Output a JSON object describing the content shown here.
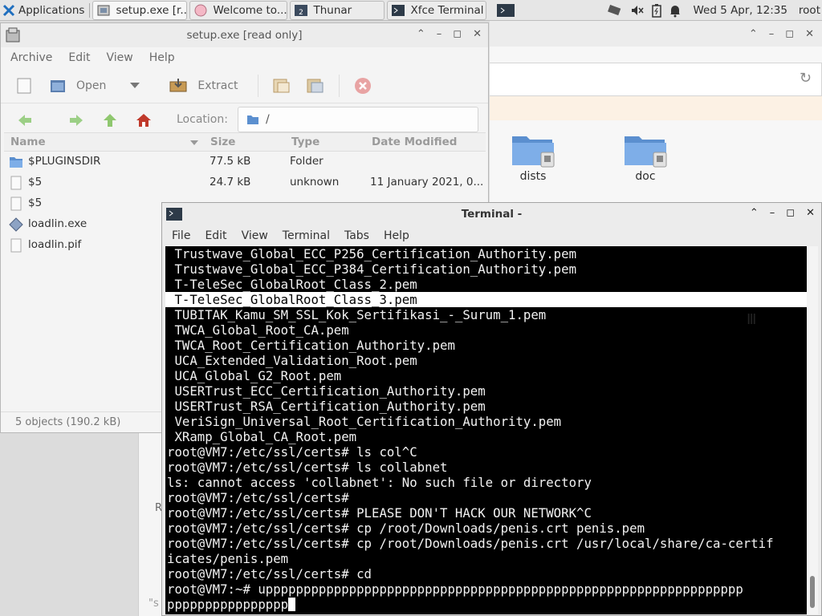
{
  "panel": {
    "applications_label": "Applications",
    "tasks": [
      {
        "label": "setup.exe [r..."
      },
      {
        "label": "Welcome to..."
      },
      {
        "label": "Thunar"
      },
      {
        "label": "Xfce Terminal"
      }
    ],
    "clock": "Wed  5 Apr, 12:35",
    "user": "root"
  },
  "thunar": {
    "folders": [
      {
        "label": "dists"
      },
      {
        "label": "doc"
      }
    ],
    "partial_left_text": "R",
    "partial_left_text2": "\"s"
  },
  "archive": {
    "title": "setup.exe [read only]",
    "menu": [
      "Archive",
      "Edit",
      "View",
      "Help"
    ],
    "toolbar": {
      "open_label": "Open",
      "extract_label": "Extract"
    },
    "location_label": "Location:",
    "location_value": "/",
    "columns": {
      "name": "Name",
      "size": "Size",
      "type": "Type",
      "date": "Date Modified"
    },
    "files": [
      {
        "name": "$PLUGINSDIR",
        "size": "77.5 kB",
        "type": "Folder",
        "date": ""
      },
      {
        "name": "$5",
        "size": "24.7 kB",
        "type": "unknown",
        "date": "11 January 2021, 0..."
      },
      {
        "name": "$5",
        "size": "",
        "type": "",
        "date": ""
      },
      {
        "name": "loadlin.exe",
        "size": "",
        "type": "",
        "date": ""
      },
      {
        "name": "loadlin.pif",
        "size": "",
        "type": "",
        "date": ""
      }
    ],
    "status": "5 objects (190.2 kB)"
  },
  "terminal": {
    "title": "Terminal -",
    "menu": [
      "File",
      "Edit",
      "View",
      "Terminal",
      "Tabs",
      "Help"
    ],
    "lines": [
      " Trustwave_Global_ECC_P256_Certification_Authority.pem",
      " Trustwave_Global_ECC_P384_Certification_Authority.pem",
      " T-TeleSec_GlobalRoot_Class_2.pem",
      " T-TeleSec_GlobalRoot_Class_3.pem",
      " TUBITAK_Kamu_SM_SSL_Kok_Sertifikasi_-_Surum_1.pem",
      " TWCA_Global_Root_CA.pem",
      " TWCA_Root_Certification_Authority.pem",
      " UCA_Extended_Validation_Root.pem",
      " UCA_Global_G2_Root.pem",
      " USERTrust_ECC_Certification_Authority.pem",
      " USERTrust_RSA_Certification_Authority.pem",
      " VeriSign_Universal_Root_Certification_Authority.pem",
      " XRamp_Global_CA_Root.pem",
      "root@VM7:/etc/ssl/certs# ls col^C",
      "root@VM7:/etc/ssl/certs# ls collabnet",
      "ls: cannot access 'collabnet': No such file or directory",
      "root@VM7:/etc/ssl/certs#",
      "root@VM7:/etc/ssl/certs# PLEASE DON'T HACK OUR NETWORK^C",
      "root@VM7:/etc/ssl/certs# cp /root/Downloads/penis.crt penis.pem",
      "root@VM7:/etc/ssl/certs# cp /root/Downloads/penis.crt /usr/local/share/ca-certif",
      "icates/penis.pem",
      "root@VM7:/etc/ssl/certs# cd",
      "root@VM7:~# uppppppppppppppppppppppppppppppppppppppppppppppppppppppppppppppp",
      "pppppppppppppppp"
    ],
    "highlighted_line": 3
  }
}
